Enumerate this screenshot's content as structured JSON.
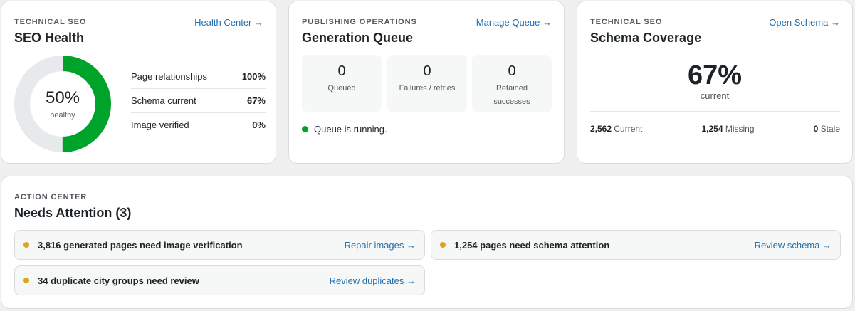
{
  "colors": {
    "accent_link": "#2271b1",
    "healthy_green": "#00a32a",
    "track_gray": "#e8e9ec",
    "warning_amber": "#dba617",
    "running_green": "#00a32a"
  },
  "seo_health": {
    "eyebrow": "TECHNICAL SEO",
    "title": "SEO Health",
    "link": "Health Center →",
    "donut": {
      "value_percent": 50,
      "value_text": "50%",
      "label": "healthy"
    },
    "metrics": [
      {
        "label": "Page relationships",
        "value": "100%"
      },
      {
        "label": "Schema current",
        "value": "67%"
      },
      {
        "label": "Image verified",
        "value": "0%"
      }
    ]
  },
  "generation_queue": {
    "eyebrow": "PUBLISHING OPERATIONS",
    "title": "Generation Queue",
    "link": "Manage Queue →",
    "stats": [
      {
        "value": "0",
        "label": "Queued"
      },
      {
        "value": "0",
        "label": "Failures / retries"
      },
      {
        "value": "0",
        "label": "Retained successes"
      }
    ],
    "status_text": "Queue is running."
  },
  "schema_coverage": {
    "eyebrow": "TECHNICAL SEO",
    "title": "Schema Coverage",
    "link": "Open Schema →",
    "big_value": "67%",
    "big_label": "current",
    "stats": [
      {
        "value": "2,562",
        "label": "Current"
      },
      {
        "value": "1,254",
        "label": "Missing"
      },
      {
        "value": "0",
        "label": "Stale"
      }
    ]
  },
  "action_center": {
    "eyebrow": "ACTION CENTER",
    "title": "Needs Attention (3)",
    "items": [
      {
        "text": "3,816 generated pages need image verification",
        "link": "Repair images →"
      },
      {
        "text": "1,254 pages need schema attention",
        "link": "Review schema →"
      },
      {
        "text": "34 duplicate city groups need review",
        "link": "Review duplicates →"
      }
    ]
  }
}
